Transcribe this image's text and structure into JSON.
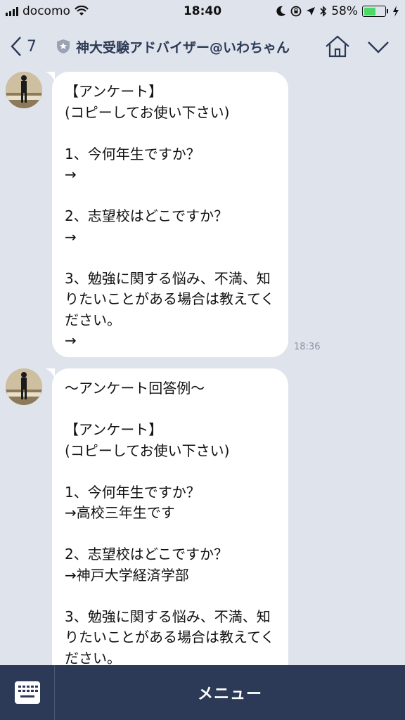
{
  "status_bar": {
    "carrier": "docomo",
    "time": "18:40",
    "battery_percent": "58%",
    "battery_level": 0.58,
    "icons": [
      "signal-icon",
      "wifi-icon",
      "moon-icon",
      "rotation-lock-icon",
      "location-icon",
      "bluetooth-icon",
      "battery-icon",
      "charging-icon"
    ]
  },
  "header": {
    "back_count": "7",
    "title": "神大受験アドバイザー@いわちゃん",
    "icons": [
      "back-chevron-icon",
      "shield-icon",
      "home-icon",
      "chevron-down-icon"
    ]
  },
  "messages": [
    {
      "text": "【アンケート】\n(コピーしてお使い下さい)\n\n1、今何年生ですか？\n→\n\n2、志望校はどこですか？\n→\n\n3、勉強に関する悩み、不満、知りたいことがある場合は教えてください。\n→",
      "time": "18:36"
    },
    {
      "text": "〜アンケート回答例〜\n\n【アンケート】\n(コピーしてお使い下さい)\n\n1、今何年生ですか？\n→高校三年生です\n\n2、志望校はどこですか？\n→神戸大学経済学部\n\n3、勉強に関する悩み、不満、知りたいことがある場合は教えてください。",
      "time": ""
    }
  ],
  "bottom_bar": {
    "menu_label": "メニュー",
    "icons": [
      "keyboard-icon"
    ]
  },
  "colors": {
    "background": "#dfe3ec",
    "bubble": "#ffffff",
    "bottom_bar": "#2c3a58",
    "header_text": "#2b3a55",
    "battery": "#4cd964"
  }
}
